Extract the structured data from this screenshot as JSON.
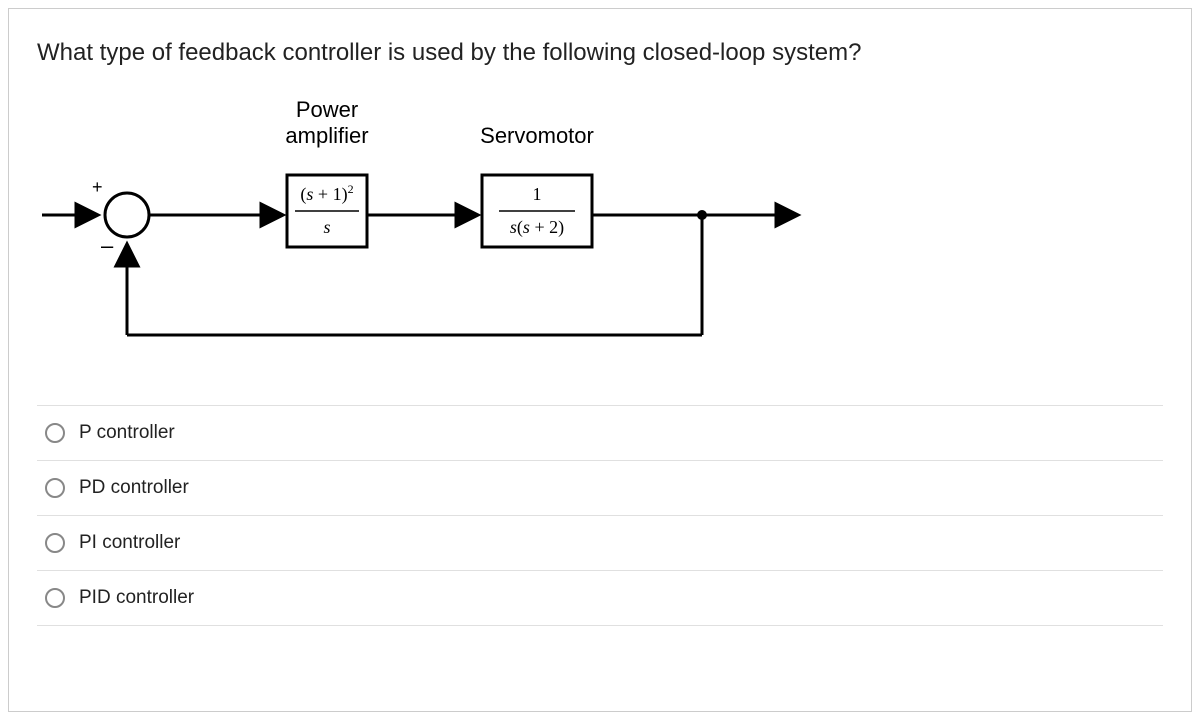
{
  "question": "What type of feedback controller is used by the following closed-loop system?",
  "diagram": {
    "block1_label_line1": "Power",
    "block1_label_line2": "amplifier",
    "block2_label": "Servomotor",
    "sum_plus": "+",
    "sum_minus": "–",
    "tf1_num_left": "(",
    "tf1_num_s": "s",
    "tf1_num_rest": " + 1)",
    "tf1_num_exp": "2",
    "tf1_den": "s",
    "tf2_num": "1",
    "tf2_den_s1": "s",
    "tf2_den_lp": "(",
    "tf2_den_s2": "s",
    "tf2_den_rest": " + 2)"
  },
  "options": [
    {
      "label": "P controller"
    },
    {
      "label": "PD controller"
    },
    {
      "label": "PI controller"
    },
    {
      "label": "PID controller"
    }
  ]
}
